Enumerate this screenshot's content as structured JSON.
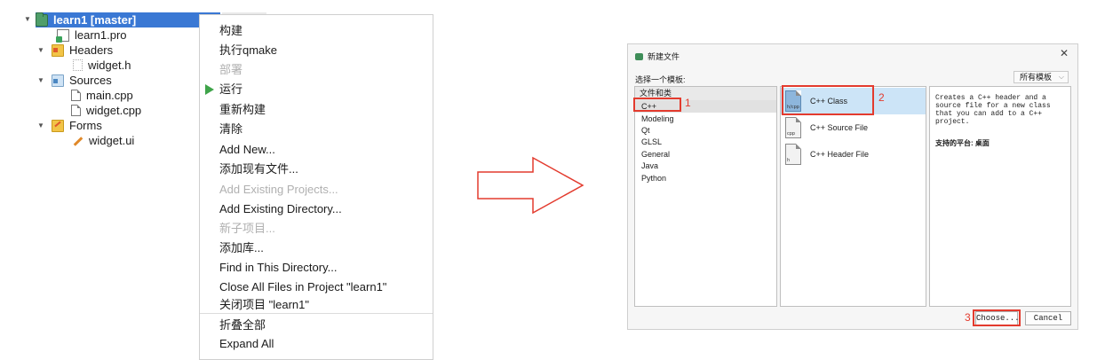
{
  "project_tree": {
    "project": "learn1 [master]",
    "items": [
      {
        "label": "learn1.pro"
      },
      {
        "label": "Headers"
      },
      {
        "label": "widget.h"
      },
      {
        "label": "Sources"
      },
      {
        "label": "main.cpp"
      },
      {
        "label": "widget.cpp"
      },
      {
        "label": "Forms"
      },
      {
        "label": "widget.ui"
      }
    ]
  },
  "context_menu": {
    "items": [
      {
        "label": "构建"
      },
      {
        "label": "执行qmake"
      },
      {
        "label": "部署"
      },
      {
        "label": "运行"
      },
      {
        "label": "重新构建"
      },
      {
        "label": "清除"
      },
      {
        "label": "Add New..."
      },
      {
        "label": "添加现有文件..."
      },
      {
        "label": "Add Existing Projects..."
      },
      {
        "label": "Add Existing Directory..."
      },
      {
        "label": "新子项目..."
      },
      {
        "label": "添加库..."
      },
      {
        "label": "Find in This Directory..."
      },
      {
        "label": "Close All Files in Project \"learn1\""
      },
      {
        "label": "关闭项目 \"learn1\""
      },
      {
        "label": "折叠全部"
      },
      {
        "label": "Expand All"
      }
    ]
  },
  "dialog": {
    "title": "新建文件",
    "close_icon": "✕",
    "choose_template_label": "选择一个模板:",
    "filter_value": "所有模板",
    "categories_header": "文件和类",
    "categories": [
      "C++",
      "Modeling",
      "Qt",
      "GLSL",
      "General",
      "Java",
      "Python"
    ],
    "templates": [
      {
        "label": "C++ Class",
        "icon_text": "h/cpp"
      },
      {
        "label": "C++ Source File",
        "icon_text": "cpp"
      },
      {
        "label": "C++ Header File",
        "icon_text": "h"
      }
    ],
    "description": "Creates a C++ header and a source file for a new class that you can add to a C++ project.",
    "platform_text": "支持的平台: 桌面",
    "choose_button": "Choose...",
    "cancel_button": "Cancel"
  },
  "annotations": {
    "step1": "1",
    "step2": "2",
    "step3": "3",
    "color": "#e33b2e"
  }
}
